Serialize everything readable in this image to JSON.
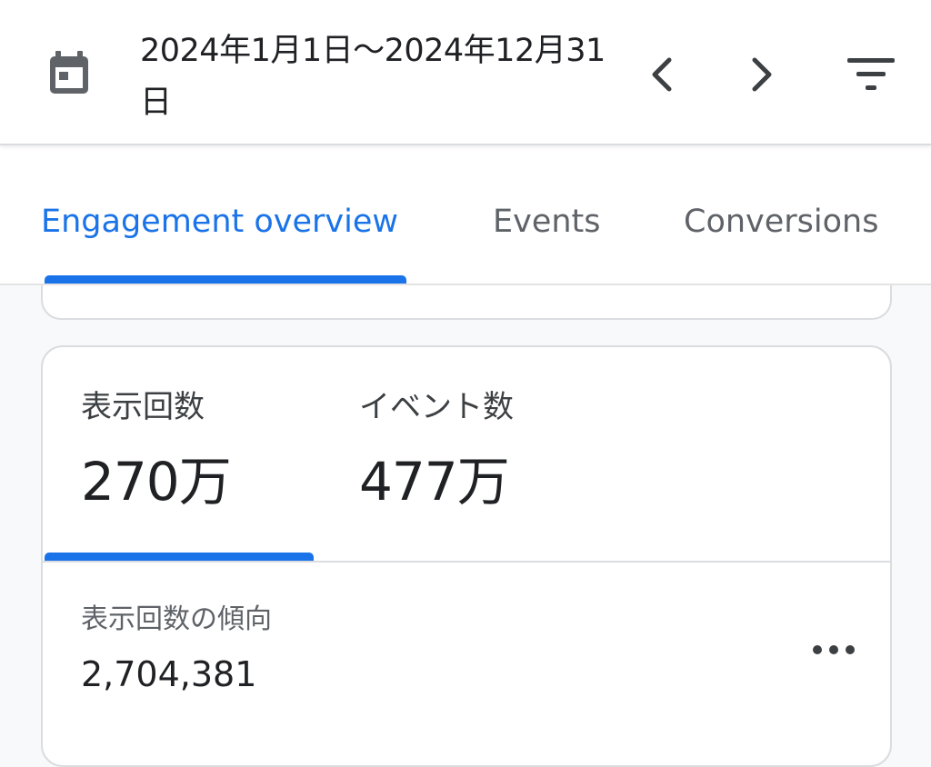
{
  "header": {
    "calendar_icon": "calendar-icon",
    "date_range": "2024年1月1日～2024年12月31日",
    "prev_icon": "chevron-left-icon",
    "next_icon": "chevron-right-icon",
    "filter_icon": "filter-icon"
  },
  "tabs": [
    {
      "label": "Engagement overview",
      "active": true
    },
    {
      "label": "Events",
      "active": false
    },
    {
      "label": "Conversions",
      "active": false
    }
  ],
  "metrics": [
    {
      "label": "表示回数",
      "value": "270万",
      "selected": true
    },
    {
      "label": "イベント数",
      "value": "477万",
      "selected": false
    }
  ],
  "trend": {
    "label": "表示回数の傾向",
    "value": "2,704,381",
    "more_icon": "more-horizontal-icon"
  },
  "colors": {
    "accent": "#1a73e8",
    "text_primary": "#202124",
    "text_secondary": "#5f6368",
    "border": "#dadce0",
    "background": "#f8f9fa"
  }
}
